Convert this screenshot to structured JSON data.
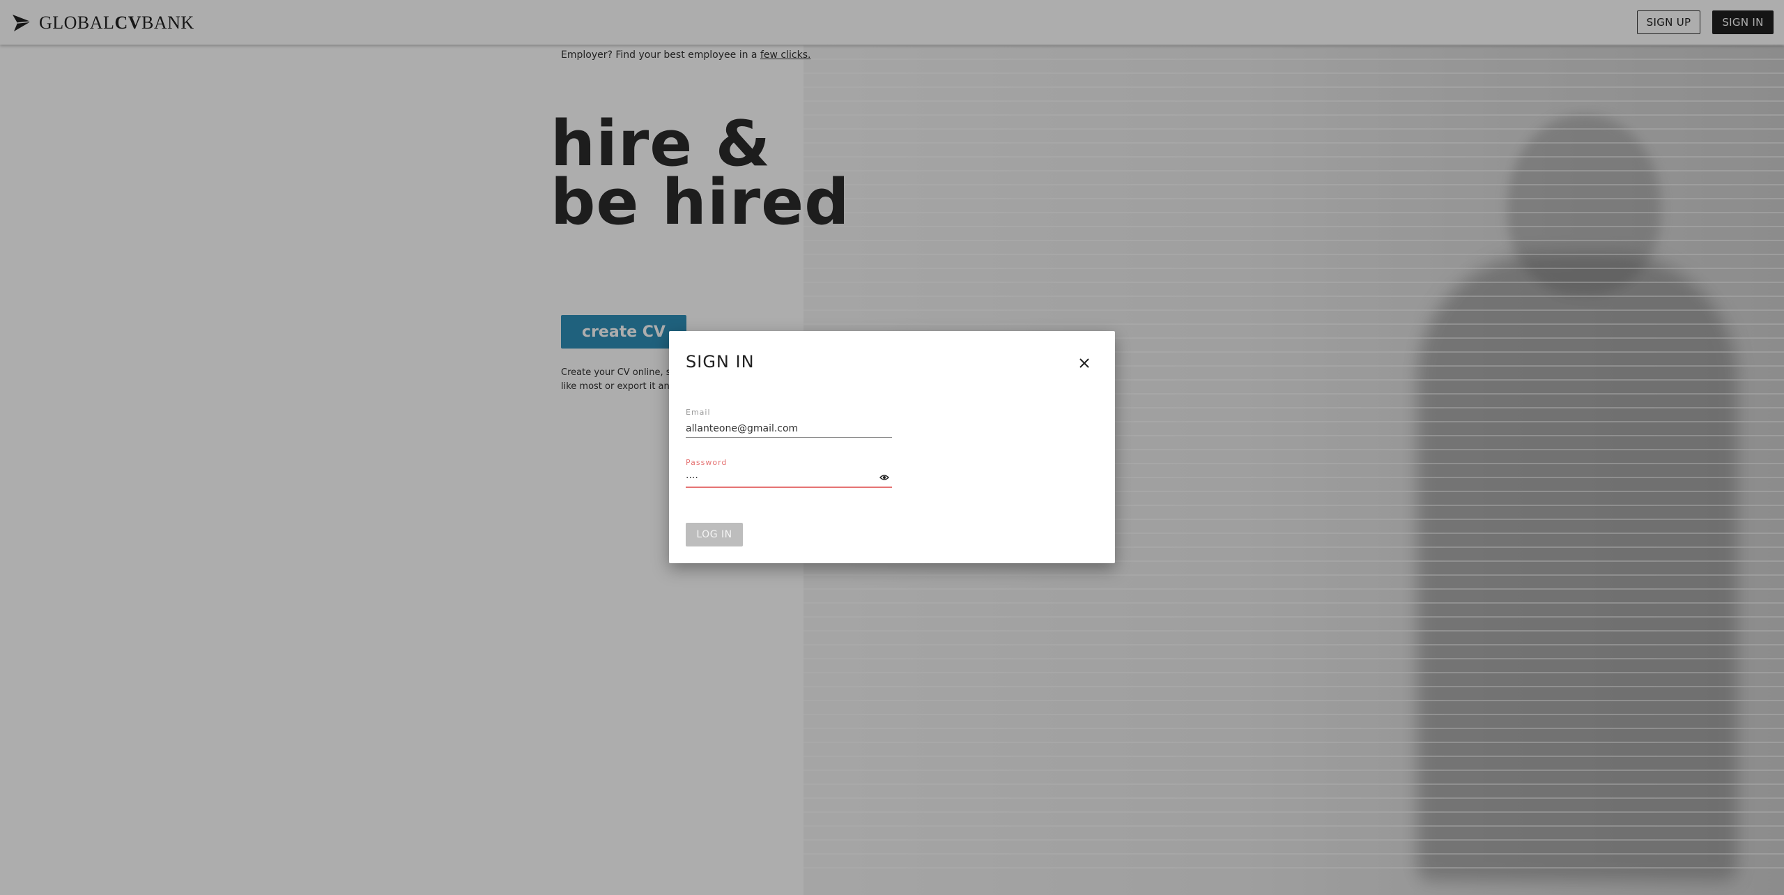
{
  "header": {
    "logo_prefix": "GLOBAL",
    "logo_bold": "CV",
    "logo_suffix": "BANK",
    "signup_label": "SIGN UP",
    "signin_label": "SIGN IN"
  },
  "hero": {
    "employer_text": "Employer? Find your best employee in a ",
    "employer_link": "few clicks.",
    "headline_line1": "hire &",
    "headline_line2": "be hired",
    "create_cv_label": "create CV",
    "create_desc": "Create your CV online, select the template you like most or export it and use anywhere."
  },
  "modal": {
    "title": "SIGN IN",
    "email_label": "Email",
    "email_value": "allanteone@gmail.com",
    "password_label": "Password",
    "password_value": "····",
    "login_label": "LOG IN"
  },
  "colors": {
    "accent": "#2e8fb8",
    "error": "#e57373",
    "overlay": "rgba(0,0,0,0.32)"
  },
  "icons": {
    "logo": "paper-plane-icon",
    "close": "close-icon",
    "toggle_password": "eye-icon"
  }
}
